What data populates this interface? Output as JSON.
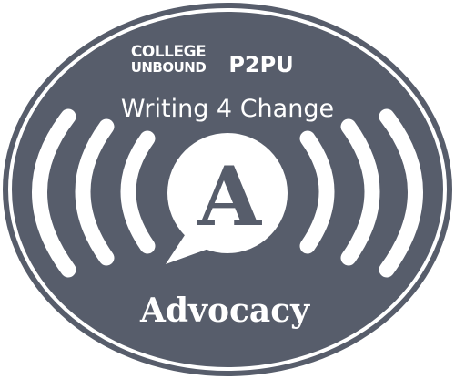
{
  "badge": {
    "logo_line1": "COLLEGE",
    "logo_line2": "UNBOUND",
    "partner_logo": "P2PU",
    "course_title": "Writing 4 Change",
    "center_letter": "A",
    "badge_name": "Advocacy",
    "icon": "speech-bubble-broadcast-icon",
    "colors": {
      "background": "#575d6b",
      "foreground": "#ffffff",
      "outer_ring": "#575d6b"
    }
  }
}
